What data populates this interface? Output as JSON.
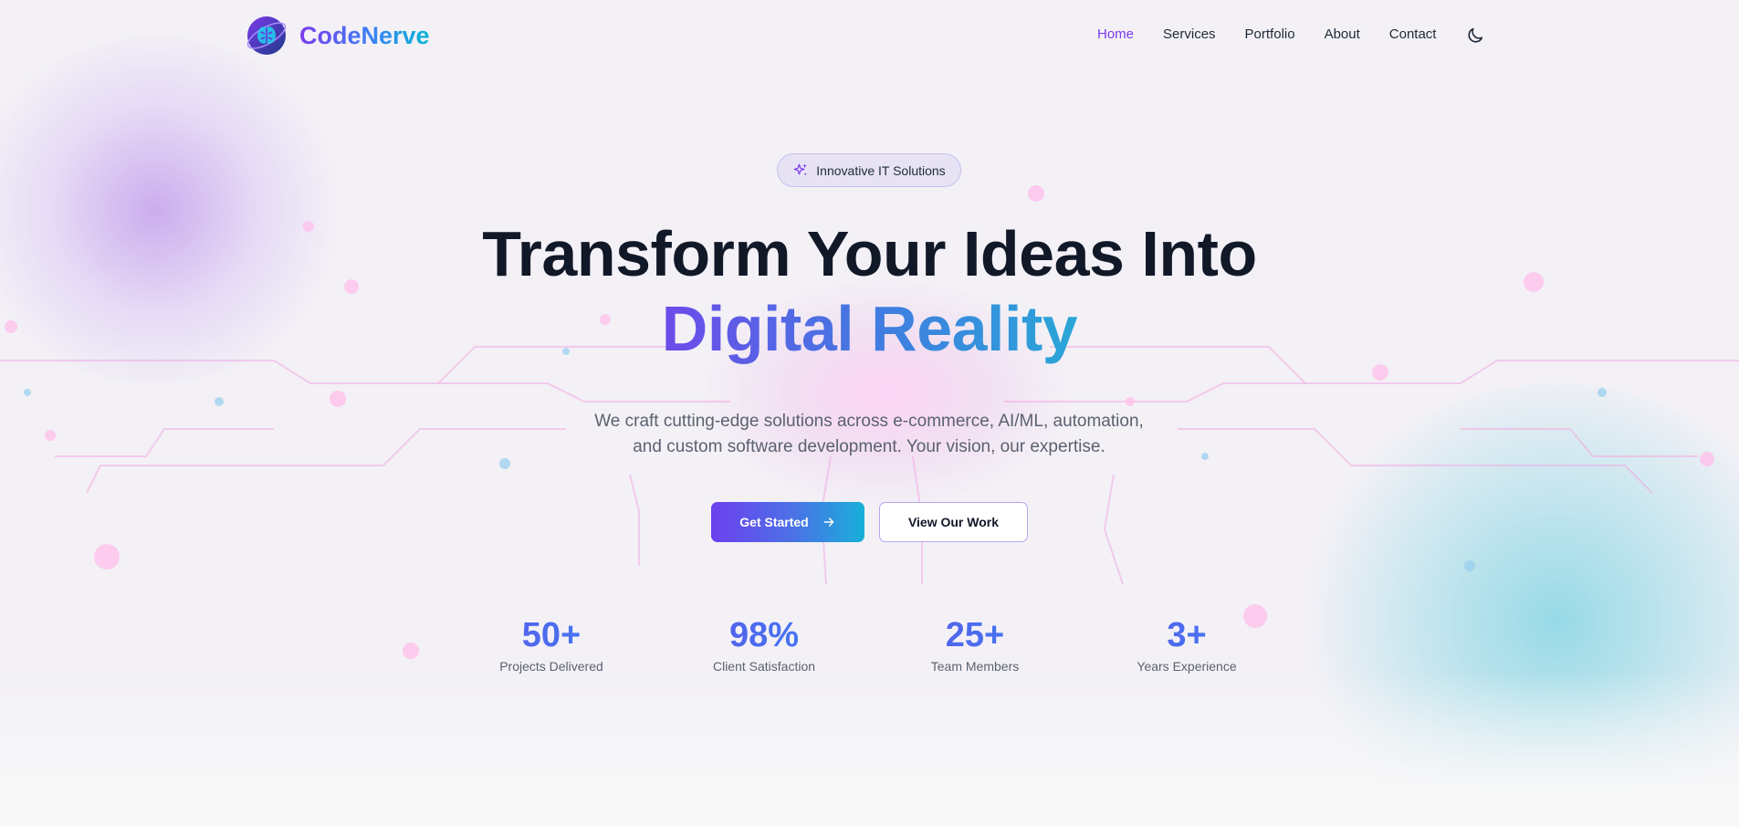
{
  "brand": {
    "name": "CodeNerve",
    "logo_icon": "brain-globe-icon"
  },
  "nav": {
    "items": [
      {
        "label": "Home",
        "active": true
      },
      {
        "label": "Services",
        "active": false
      },
      {
        "label": "Portfolio",
        "active": false
      },
      {
        "label": "About",
        "active": false
      },
      {
        "label": "Contact",
        "active": false
      }
    ],
    "theme_toggle_icon": "moon-icon"
  },
  "hero": {
    "badge": {
      "icon": "sparkles-icon",
      "label": "Innovative IT Solutions"
    },
    "title_line1": "Transform Your Ideas Into",
    "title_line2": "Digital Reality",
    "subtitle_line1": "We craft cutting-edge solutions across e-commerce, AI/ML, automation,",
    "subtitle_line2": "and custom software development. Your vision, our expertise.",
    "primary_button": {
      "label": "Get Started",
      "icon": "arrow-right-icon"
    },
    "secondary_button": {
      "label": "View Our Work"
    }
  },
  "stats": [
    {
      "value": "50+",
      "label": "Projects Delivered"
    },
    {
      "value": "98%",
      "label": "Client Satisfaction"
    },
    {
      "value": "25+",
      "label": "Team Members"
    },
    {
      "value": "3+",
      "label": "Years Experience"
    }
  ],
  "colors": {
    "accent_purple": "#7c3aed",
    "accent_blue": "#3b82f6",
    "accent_cyan": "#06b6d4",
    "heading_dark": "#111827",
    "body_gray": "#5b6170"
  }
}
